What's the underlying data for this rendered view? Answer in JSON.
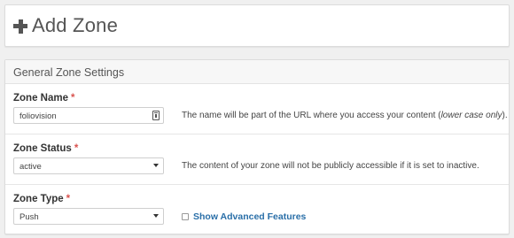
{
  "header": {
    "title": "Add Zone",
    "icon": "plus-icon"
  },
  "panel": {
    "heading": "General Zone Settings",
    "fields": [
      {
        "label": "Zone Name",
        "required_mark": "*",
        "value": "foliovision",
        "help_before": "The name will be part of the URL where you access your content (",
        "help_em": "lower case only",
        "help_after": ")."
      },
      {
        "label": "Zone Status",
        "required_mark": "*",
        "value": "active",
        "help": "The content of your zone will not be publicly accessible if it is set to inactive."
      },
      {
        "label": "Zone Type",
        "required_mark": "*",
        "value": "Push",
        "checkbox_label": "Show Advanced Features",
        "checkbox_checked": false
      }
    ]
  },
  "colors": {
    "required": "#d9534f",
    "link": "#2a6fa8"
  }
}
